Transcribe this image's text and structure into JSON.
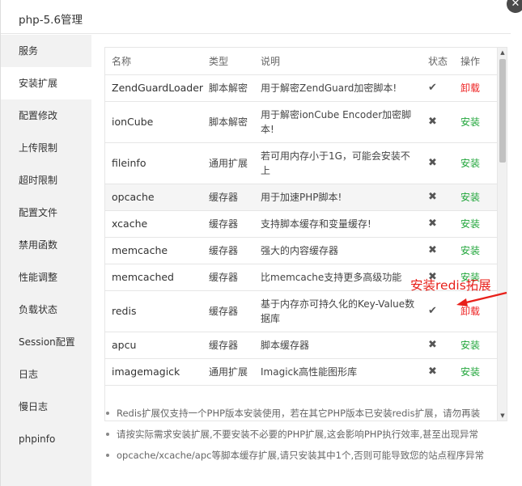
{
  "dialog": {
    "title": "php-5.6管理"
  },
  "sidebar": {
    "items": [
      {
        "label": "服务"
      },
      {
        "label": "安装扩展"
      },
      {
        "label": "配置修改"
      },
      {
        "label": "上传限制"
      },
      {
        "label": "超时限制"
      },
      {
        "label": "配置文件"
      },
      {
        "label": "禁用函数"
      },
      {
        "label": "性能调整"
      },
      {
        "label": "负载状态"
      },
      {
        "label": "Session配置"
      },
      {
        "label": "日志"
      },
      {
        "label": "慢日志"
      },
      {
        "label": "phpinfo"
      }
    ],
    "active_index": 1
  },
  "table": {
    "headers": {
      "name": "名称",
      "type": "类型",
      "desc": "说明",
      "status": "状态",
      "action": "操作"
    },
    "rows": [
      {
        "name": "ZendGuardLoader",
        "type": "脚本解密",
        "desc": "用于解密ZendGuard加密脚本!",
        "installed": true,
        "action": "卸载"
      },
      {
        "name": "ionCube",
        "type": "脚本解密",
        "desc": "用于解密ionCube Encoder加密脚本!",
        "installed": false,
        "action": "安装"
      },
      {
        "name": "fileinfo",
        "type": "通用扩展",
        "desc": "若可用内存小于1G，可能会安装不上",
        "installed": false,
        "action": "安装"
      },
      {
        "name": "opcache",
        "type": "缓存器",
        "desc": "用于加速PHP脚本!",
        "installed": false,
        "action": "安装"
      },
      {
        "name": "xcache",
        "type": "缓存器",
        "desc": "支持脚本缓存和变量缓存!",
        "installed": false,
        "action": "安装"
      },
      {
        "name": "memcache",
        "type": "缓存器",
        "desc": "强大的内容缓存器",
        "installed": false,
        "action": "安装"
      },
      {
        "name": "memcached",
        "type": "缓存器",
        "desc": "比memcache支持更多高级功能",
        "installed": false,
        "action": "安装"
      },
      {
        "name": "redis",
        "type": "缓存器",
        "desc": "基于内存亦可持久化的Key-Value数据库",
        "installed": true,
        "action": "卸载"
      },
      {
        "name": "apcu",
        "type": "缓存器",
        "desc": "脚本缓存器",
        "installed": false,
        "action": "安装"
      },
      {
        "name": "imagemagick",
        "type": "通用扩展",
        "desc": "Imagick高性能图形库",
        "installed": false,
        "action": "安装"
      }
    ]
  },
  "notes": [
    "Redis扩展仅支持一个PHP版本安装使用，若在其它PHP版本已安装redis扩展，请勿再装",
    "请按实际需求安装扩展,不要安装不必要的PHP扩展,这会影响PHP执行效率,甚至出现异常",
    "opcache/xcache/apc等脚本缓存扩展,请只安装其中1个,否则可能导致您的站点程序异常"
  ],
  "annotation": {
    "text": "安装redis拓展"
  },
  "icons": {
    "installed": "check-icon",
    "not_installed": "cross-icon",
    "close": "close-icon"
  },
  "colors": {
    "install": "#20a53a",
    "uninstall": "#e22222",
    "annotation": "#e8201a"
  }
}
